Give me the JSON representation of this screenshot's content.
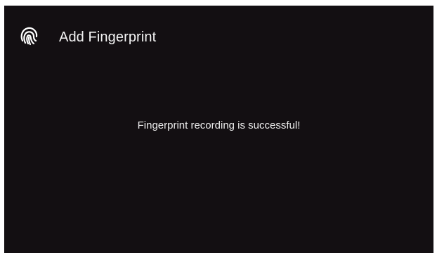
{
  "header": {
    "icon": "fingerprint-icon",
    "title": "Add Fingerprint"
  },
  "main": {
    "message": "Fingerprint recording is successful!"
  },
  "colors": {
    "background": "#130f12",
    "text": "#ffffff"
  }
}
